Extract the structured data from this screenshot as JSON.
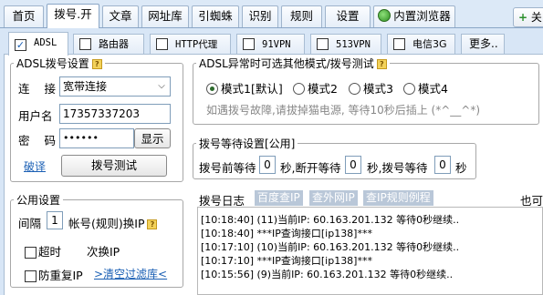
{
  "top_tabs": [
    "首页",
    "拨号.开",
    "文章",
    "网址库",
    "引蜘蛛",
    "识别",
    "规则",
    "设置",
    "内置浏览器"
  ],
  "close_label": "关",
  "sub_tabs": [
    {
      "label": "ADSL",
      "checked": true
    },
    {
      "label": "路由器",
      "checked": false
    },
    {
      "label": "HTTP代理",
      "checked": false
    },
    {
      "label": "91VPN",
      "checked": false
    },
    {
      "label": "513VPN",
      "checked": false
    },
    {
      "label": "电信3G",
      "checked": false
    },
    {
      "label": "更多..",
      "checked": null
    }
  ],
  "adsl": {
    "title": "ADSL拨号设置",
    "connect_label": "连  接",
    "connect_value": "宽带连接",
    "user_label": "用户名",
    "user_value": "17357337203",
    "password_label": "密  码",
    "password_value": "••••••",
    "show_button": "显示",
    "break_link": "破译",
    "test_button": "拨号测试"
  },
  "public": {
    "title": "公用设置",
    "interval_label": "间隔",
    "interval_value": "1",
    "interval_suffix": "帐号(规则)换IP",
    "timeout_label": "超时",
    "change_ip_label": "次换IP",
    "dup_ip_label": "防重复IP",
    "clear_filter_link": ">清空过滤库<"
  },
  "abnormal": {
    "title": "ADSL异常时可选其他模式/拨号测试",
    "modes": [
      "模式1[默认]",
      "模式2",
      "模式3",
      "模式4"
    ],
    "selected_mode": 0,
    "hint": "如遇拨号故障,请拔掉猫电源, 等待10秒后插上 (*^__^*)"
  },
  "wait": {
    "title": "拨号等待设置[公用]",
    "before_label": "拨号前等待",
    "before_value": "0",
    "before_unit": "秒,断开等待",
    "disconnect_value": "0",
    "disconnect_unit": "秒,拨号等待",
    "dial_value": "0",
    "dial_unit": "秒"
  },
  "log": {
    "title": "拨号日志",
    "links": [
      "百度查IP",
      "查外网IP",
      "查IP规则例程"
    ],
    "right_text": "也可",
    "lines": [
      "[10:18:40] (11)当前IP: 60.163.201.132 等待0秒继续..",
      "[10:18:40] ***IP查询接口[ip138]***",
      "[10:17:10] (10)当前IP: 60.163.201.132 等待0秒继续..",
      "[10:17:10] ***IP查询接口[ip138]***",
      "[10:15:56] (9)当前IP: 60.163.201.132 等待0秒继续.."
    ]
  }
}
